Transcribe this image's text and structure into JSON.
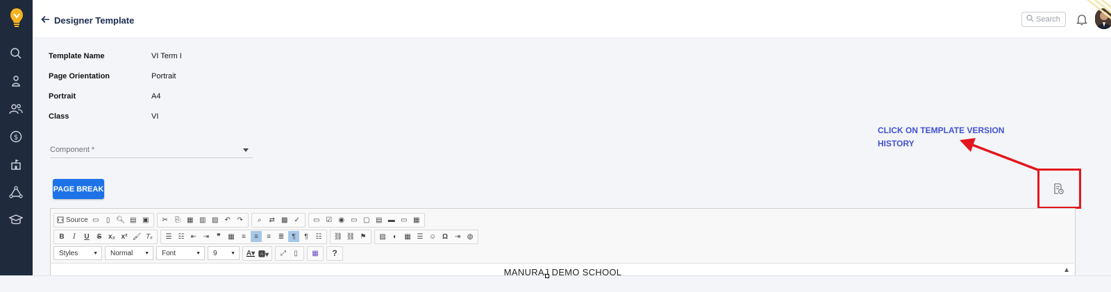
{
  "sidebar": {
    "items": [
      {
        "icon": "search-icon"
      },
      {
        "icon": "student-icon"
      },
      {
        "icon": "users-icon"
      },
      {
        "icon": "dollar-icon"
      },
      {
        "icon": "building-icon"
      },
      {
        "icon": "network-icon"
      },
      {
        "icon": "graduation-icon"
      }
    ]
  },
  "header": {
    "back_label": "Designer Template",
    "search_placeholder": "Search"
  },
  "template_info": [
    {
      "label": "Template Name",
      "value": "VI Term I"
    },
    {
      "label": "Page Orientation",
      "value": "Portrait"
    },
    {
      "label": "Portrait",
      "value": "A4"
    },
    {
      "label": "Class",
      "value": "VI"
    }
  ],
  "component": {
    "label": "Component *"
  },
  "page_break_label": "PAGE BREAK",
  "annotation": {
    "line1": "CLICK ON TEMPLATE VERSION",
    "line2": "HISTORY",
    "color": "#4251d3",
    "highlight_color": "#e3161d"
  },
  "editor": {
    "source_label": "Source",
    "styles_combo": "Styles",
    "format_combo": "Normal",
    "font_combo": "Font",
    "size_combo": "9",
    "help_label": "?",
    "content_text": "MANURAJ DEMO SCHOOL"
  },
  "colors": {
    "sidebar": "#1f2a3c",
    "primary_button": "#1d72e8"
  }
}
